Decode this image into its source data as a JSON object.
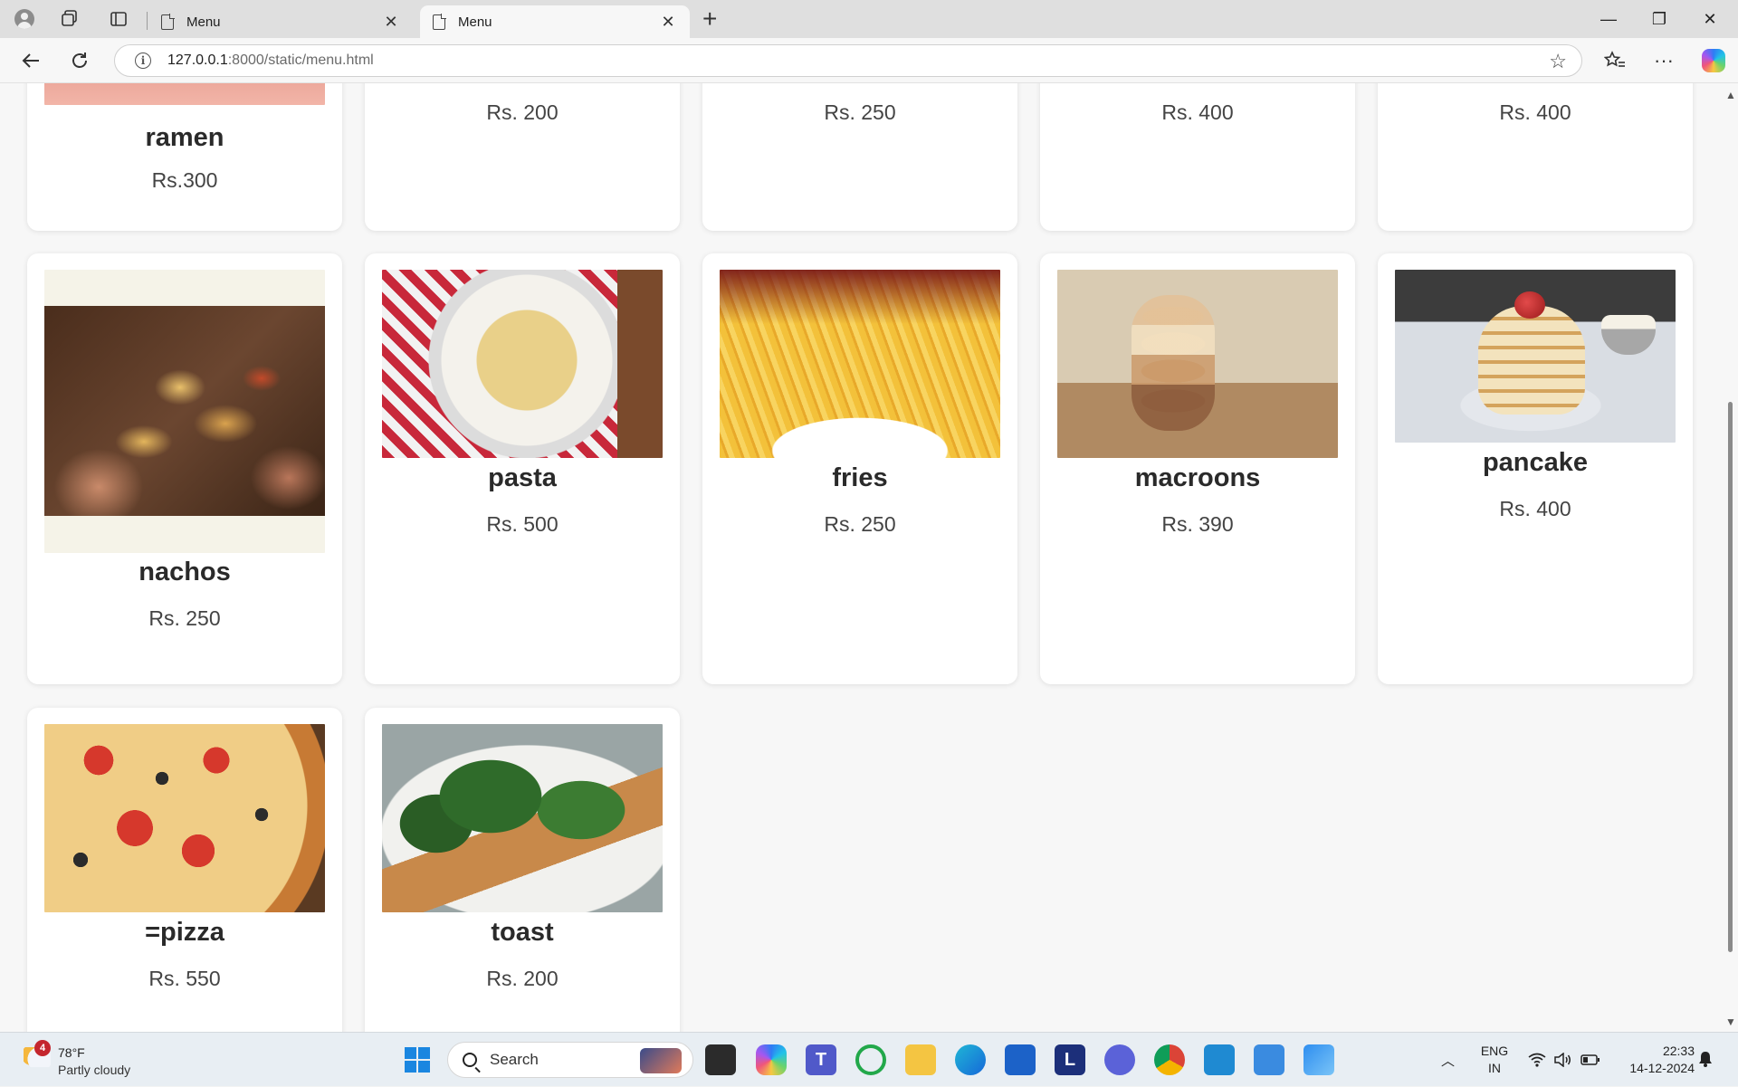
{
  "browser": {
    "tabs": [
      {
        "title": "Menu",
        "active": false,
        "close": "✕"
      },
      {
        "title": "Menu",
        "active": true,
        "close": "✕"
      }
    ],
    "new_tab": "+",
    "url_host": "127.0.0.1",
    "url_rest": ":8000/static/menu.html",
    "window_controls": [
      "—",
      "❐",
      "✕"
    ]
  },
  "menu": {
    "partial_top_row": [
      {
        "name": "ramen",
        "price": "Rs.300"
      },
      {
        "price": "Rs. 200"
      },
      {
        "price": "Rs. 250"
      },
      {
        "price": "Rs. 400"
      },
      {
        "price": "Rs. 400"
      }
    ],
    "items": [
      {
        "name": "nachos",
        "price": "Rs. 250",
        "image": "nachos-photo"
      },
      {
        "name": "pasta",
        "price": "Rs. 500",
        "image": "pasta-photo"
      },
      {
        "name": "fries",
        "price": "Rs. 250",
        "image": "fries-photo"
      },
      {
        "name": "macroons",
        "price": "Rs. 390",
        "image": "macaroons-photo"
      },
      {
        "name": "pancake",
        "price": "Rs. 400",
        "image": "pancake-photo"
      },
      {
        "name": "=pizza",
        "price": "Rs. 550",
        "image": "pizza-photo"
      },
      {
        "name": "toast",
        "price": "Rs. 200",
        "image": "toast-photo"
      }
    ]
  },
  "taskbar": {
    "weather": {
      "badge": "4",
      "temperature": "78°F",
      "condition": "Partly cloudy"
    },
    "search_placeholder": "Search",
    "language": [
      "ENG",
      "IN"
    ],
    "time": "22:33",
    "date": "14-12-2024",
    "apps": [
      "file-explorer-icon",
      "copilot-icon",
      "teams-icon",
      "refresh-app-icon",
      "folder-icon",
      "edge-icon",
      "store-icon",
      "l-app-icon",
      "vpn-icon",
      "chrome-icon",
      "vscode-icon",
      "notepad-icon",
      "photos-icon"
    ]
  },
  "colors": {
    "accent": "#1a86e0",
    "card_bg": "#ffffff",
    "page_bg": "#f7f7f7"
  }
}
